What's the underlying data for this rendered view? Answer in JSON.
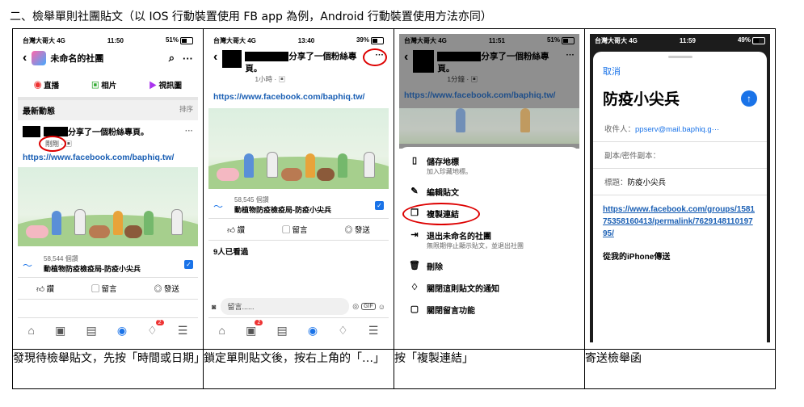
{
  "heading": "二、檢舉單則社團貼文（以 IOS 行動裝置使用 FB app 為例，Android 行動裝置使用方法亦同）",
  "captions": [
    "發現待檢舉貼文，先按「時間或日期」",
    "鎖定單則貼文後，按右上角的「…」",
    "按「複製連結」",
    "寄送檢舉函"
  ],
  "link": "https://www.facebook.com/baphiq.tw/",
  "shot1": {
    "status": {
      "carrier": "台灣大哥大 4G",
      "time": "11:50",
      "battery": "51%"
    },
    "group_name": "未命名的社團",
    "tabs": [
      "直播",
      "相片",
      "視訊圖"
    ],
    "section": "最新動態",
    "sort": "排序",
    "shared": "分享了一個粉絲專頁。",
    "time_label": "剛剛",
    "page_likes": "58,544 個讚",
    "page_name": "動植物防疫檢疫局-防疫小尖兵",
    "actions": [
      "讚",
      "留言",
      "發送"
    ],
    "badge": "2"
  },
  "shot2": {
    "status": {
      "carrier": "台灣大哥大 4G",
      "time": "13:40",
      "battery": "39%"
    },
    "shared": "分享了一個粉絲專頁。",
    "meta": "1小時",
    "page_likes": "58,545 個讚",
    "page_name": "動植物防疫檢疫局-防疫小尖兵",
    "actions": [
      "讚",
      "留言",
      "發送"
    ],
    "seen": "9人已看過",
    "comment_placeholder": "留言......",
    "badge": "2"
  },
  "shot3": {
    "status": {
      "carrier": "台灣大哥大 4G",
      "time": "11:51",
      "battery": "51%"
    },
    "shared": "分享了一個粉絲專",
    "shared2": "頁。",
    "meta": "1分鐘",
    "menu": [
      {
        "label": "儲存地標",
        "sub": "加入珍藏地標。",
        "icon": "bookmark-icon"
      },
      {
        "label": "編輯貼文",
        "sub": "",
        "icon": "pencil-icon"
      },
      {
        "label": "複製連結",
        "sub": "",
        "icon": "copy-icon"
      },
      {
        "label": "退出未命名的社團",
        "sub": "無限期停止顯示貼文，並退出社團",
        "icon": "exit-icon"
      },
      {
        "label": "刪除",
        "sub": "",
        "icon": "trash-icon"
      },
      {
        "label": "關閉這則貼文的通知",
        "sub": "",
        "icon": "bell-icon"
      },
      {
        "label": "關閉留言功能",
        "sub": "",
        "icon": "comment-icon"
      }
    ]
  },
  "shot4": {
    "status": {
      "carrier": "台灣大哥大 4G",
      "time": "11:59",
      "battery": "49%"
    },
    "cancel": "取消",
    "subject_title": "防疫小尖兵",
    "to_label": "收件人：",
    "to_value": "ppserv@mail.baphiq.g···",
    "cc_label": "副本/密件副本：",
    "subj_label": "標題：",
    "subj_value": "防疫小尖兵",
    "body_link": "https://www.facebook.com/groups/158175358160413/permalink/762914811019795/",
    "signature": "從我的iPhone傳送"
  }
}
